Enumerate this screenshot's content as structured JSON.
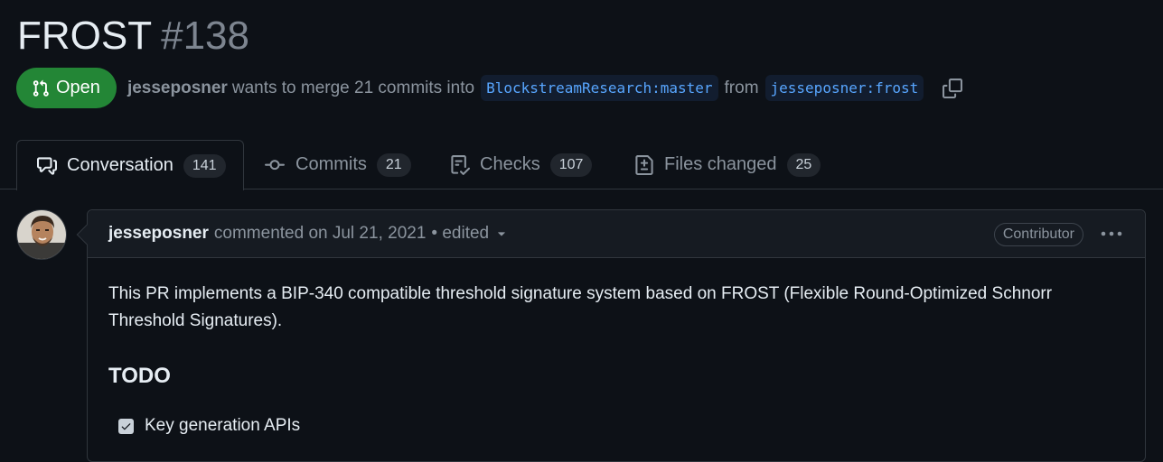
{
  "pr": {
    "title": "FROST",
    "number": "#138",
    "state": "Open",
    "author": "jesseposner",
    "merge_text": "wants to merge 21 commits into",
    "base_branch": "BlockstreamResearch:master",
    "from_text": "from",
    "head_branch": "jesseposner:frost"
  },
  "tabs": [
    {
      "label": "Conversation",
      "count": "141"
    },
    {
      "label": "Commits",
      "count": "21"
    },
    {
      "label": "Checks",
      "count": "107"
    },
    {
      "label": "Files changed",
      "count": "25"
    }
  ],
  "comment": {
    "author": "jesseposner",
    "action": "commented on Jul 21, 2021",
    "edited": "• edited",
    "role": "Contributor",
    "body": "This PR implements a BIP-340 compatible threshold signature system based on FROST (Flexible Round-Optimized Schnorr Threshold Signatures).",
    "heading": "TODO",
    "tasks": [
      {
        "label": "Key generation APIs",
        "checked": true
      }
    ]
  },
  "colors": {
    "background": "#0d1117",
    "open_badge": "#238636",
    "link": "#58a6ff",
    "border": "#30363d"
  },
  "icons": [
    "git-pull-request-icon",
    "copy-icon",
    "comment-discussion-icon",
    "git-commit-icon",
    "checklist-icon",
    "file-diff-icon",
    "triangle-down-icon",
    "kebab-horizontal-icon",
    "check-icon"
  ]
}
